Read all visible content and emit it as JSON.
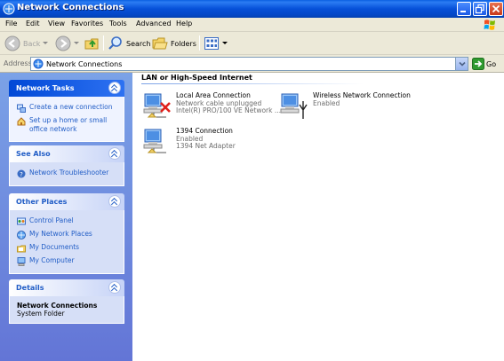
{
  "window": {
    "title": "Network Connections"
  },
  "menu": [
    {
      "label": "File"
    },
    {
      "label": "Edit"
    },
    {
      "label": "View"
    },
    {
      "label": "Favorites"
    },
    {
      "label": "Tools"
    },
    {
      "label": "Advanced"
    },
    {
      "label": "Help"
    }
  ],
  "toolbar": {
    "back_label": "Back",
    "search_label": "Search",
    "folders_label": "Folders"
  },
  "address": {
    "label": "Address",
    "value": "Network Connections",
    "go_label": "Go"
  },
  "taskpane": {
    "network_tasks": {
      "title": "Network Tasks",
      "items": [
        {
          "label": "Create a new connection"
        },
        {
          "label": "Set up a home or small office network"
        }
      ]
    },
    "see_also": {
      "title": "See Also",
      "items": [
        {
          "label": "Network Troubleshooter"
        }
      ]
    },
    "other_places": {
      "title": "Other Places",
      "items": [
        {
          "label": "Control Panel"
        },
        {
          "label": "My Network Places"
        },
        {
          "label": "My Documents"
        },
        {
          "label": "My Computer"
        }
      ]
    },
    "details": {
      "title": "Details",
      "name": "Network Connections",
      "type": "System Folder"
    }
  },
  "content": {
    "group_title": "LAN or High-Speed Internet",
    "connections": [
      {
        "name": "Local Area Connection",
        "status": "Network cable unplugged",
        "device": "Intel(R) PRO/100 VE Network ..."
      },
      {
        "name": "Wireless Network Connection",
        "status": "Enabled",
        "device": ""
      },
      {
        "name": "1394 Connection",
        "status": "Enabled",
        "device": "1394 Net Adapter"
      }
    ]
  }
}
